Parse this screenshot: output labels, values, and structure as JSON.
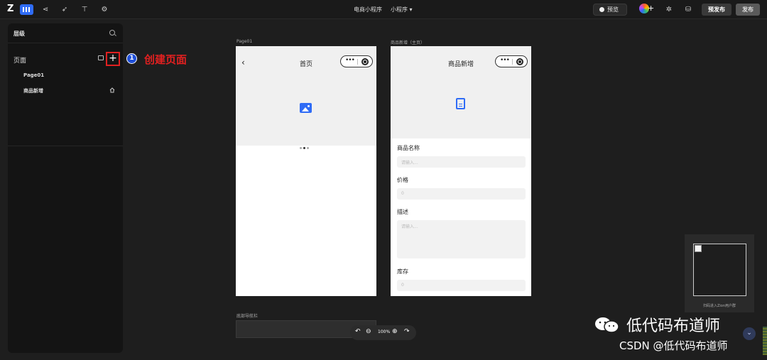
{
  "topbar": {
    "logo": "Z",
    "app_title": "电商小程序",
    "app_type": "小程序 ▾",
    "preview_label": "预览",
    "avatar_plus": "+",
    "prepublish_label": "预发布",
    "publish_label": "发布",
    "tools": [
      "layers-icon",
      "share-icon",
      "rocket-icon",
      "split-icon",
      "settings-icon"
    ]
  },
  "panel": {
    "title": "层级",
    "pages_label": "页面",
    "add_symbol": "+",
    "items": [
      {
        "label": "Page01"
      },
      {
        "label": "商品新增"
      }
    ]
  },
  "annotation": {
    "number": "1",
    "text": "创建页面"
  },
  "frames": [
    {
      "label": "Page01",
      "title": "首页",
      "back": "‹"
    },
    {
      "label": "商品新增（主页）",
      "title": "商品新增",
      "fields": [
        {
          "label": "商品名称",
          "placeholder": "请输入..."
        },
        {
          "label": "价格",
          "placeholder": "0"
        },
        {
          "label": "描述",
          "placeholder": "请输入..."
        },
        {
          "label": "库存",
          "placeholder": "0"
        }
      ]
    }
  ],
  "bottom_nav": {
    "label": "底部导航栏"
  },
  "zoom": {
    "undo": "↶",
    "minus": "⊖",
    "value": "100%",
    "plus": "⊕",
    "redo": "↷"
  },
  "qr": {
    "caption": "扫码进入Zion用户群"
  },
  "watermark": {
    "line1": "低代码布道师",
    "line2": "CSDN @低代码布道师"
  },
  "scroll_down": "⌄"
}
